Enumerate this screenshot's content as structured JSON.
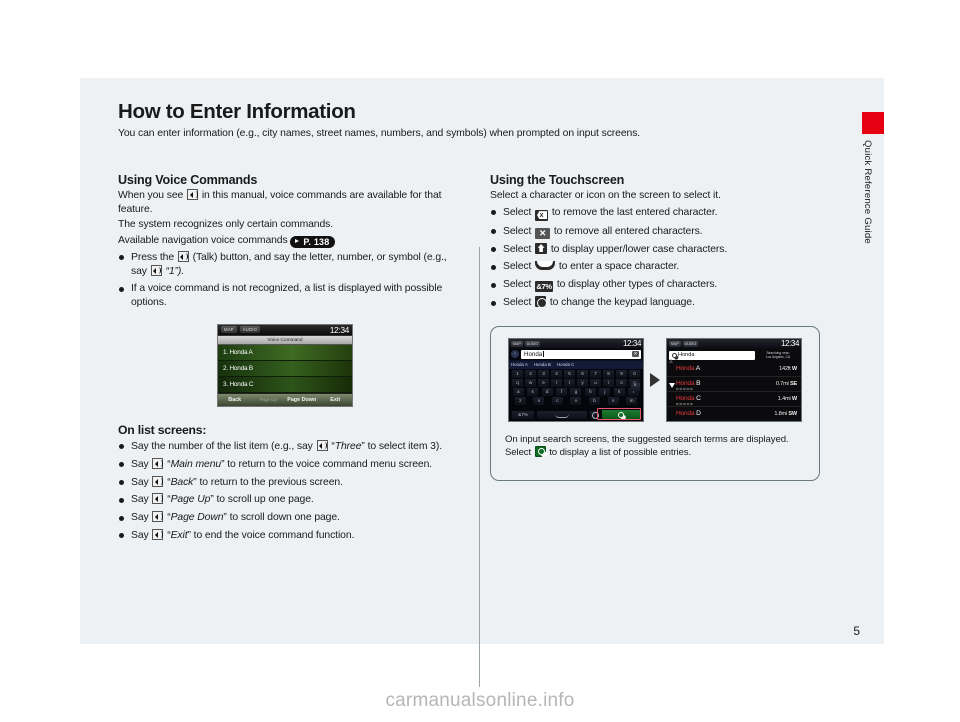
{
  "page": {
    "title": "How to Enter Information",
    "subtitle": "You can enter information (e.g., city names, street names, numbers, and symbols) when prompted on input screens.",
    "page_number": "5",
    "sidebar_label": "Quick Reference Guide",
    "sidebar_tab_color": "#e60012",
    "watermark": "carmanualsonline.info"
  },
  "left_column": {
    "heading": "Using Voice Commands",
    "para1_a": "When you see",
    "para1_b": "in this manual, voice commands are available for that feature.",
    "para2": "The system recognizes only certain commands.",
    "para3": "Available navigation voice commands",
    "page_ref": "P. 138",
    "bullets": [
      {
        "a": "Press the",
        "b": "(Talk) button, and say the letter, number, or symbol (e.g., say",
        "c": "“1”).",
        "has_second_icon": true
      },
      {
        "a": "If a voice command is not recognized, a list is displayed with possible options.",
        "b": "",
        "c": "",
        "has_second_icon": false
      }
    ],
    "nav_screen": {
      "chip_map": "MAP",
      "chip_audio": "AUDIO",
      "time": "12:34",
      "screen_title": "Voice Command",
      "list": [
        "1. Honda A",
        "2. Honda B",
        "3. Honda C"
      ],
      "buttons": [
        "Back",
        "Page Up",
        "Page Down",
        "Exit"
      ]
    },
    "subheading": "On list screens:",
    "list_bullets": [
      {
        "pre": "Say the number of the list item (e.g., say",
        "cmd": "Three",
        "post": "to select item 3)."
      },
      {
        "pre": "Say",
        "cmd": "Main menu",
        "post": "to return to the voice command menu screen."
      },
      {
        "pre": "Say",
        "cmd": "Back",
        "post": "to return to the previous screen."
      },
      {
        "pre": "Say",
        "cmd": "Page Up",
        "post": "to scroll up one page."
      },
      {
        "pre": "Say",
        "cmd": "Page Down",
        "post": "to scroll down one page."
      },
      {
        "pre": "Say",
        "cmd": "Exit",
        "post": "to end the voice command function."
      }
    ]
  },
  "right_column": {
    "heading": "Using the Touchscreen",
    "intro": "Select a character or icon on the screen to select it.",
    "bullets": [
      {
        "pre": "Select",
        "icon": "delete-character-key-icon",
        "post": "to remove the last entered character."
      },
      {
        "pre": "Select",
        "icon": "clear-all-key-icon",
        "post": "to remove all entered characters."
      },
      {
        "pre": "Select",
        "icon": "shift-key-icon",
        "post": "to display upper/lower case characters."
      },
      {
        "pre": "Select",
        "icon": "space-key-icon",
        "post": "to enter a space character."
      },
      {
        "pre": "Select",
        "icon": "symbols-key-icon",
        "label": "&7%",
        "post": "to display other types of characters."
      },
      {
        "pre": "Select",
        "icon": "keypad-language-key-icon",
        "post": "to change the keypad language."
      }
    ],
    "callout": {
      "caption_pre": "On input search screens, the suggested search terms are displayed. Select",
      "caption_icon": "search-key-icon",
      "caption_post": "to display a list of possible entries.",
      "keyboard_screen": {
        "chip_map": "MAP",
        "chip_audio": "AUDIO",
        "time": "12:34",
        "input_value": "Honda",
        "suggestions": [
          "Honda A",
          "Honda B",
          "Honda C"
        ],
        "row1": [
          "1",
          "2",
          "3",
          "4",
          "5",
          "6",
          "7",
          "8",
          "9",
          "0"
        ],
        "row2": [
          "q",
          "w",
          "e",
          "r",
          "t",
          "y",
          "u",
          "i",
          "o",
          "p"
        ],
        "row3": [
          "a",
          "s",
          "d",
          "f",
          "g",
          "h",
          "j",
          "k",
          "l"
        ],
        "row4": [
          "z",
          "x",
          "c",
          "v",
          "b",
          "n",
          "m"
        ],
        "symbols_key": "&7%"
      },
      "results_screen": {
        "chip_map": "MAP",
        "chip_audio": "AUDIO",
        "time": "12:34",
        "search_value": "Honda",
        "meta_line1": "Searching near:",
        "meta_line2": "Los Angeles, CA",
        "rows": [
          {
            "brand": "Honda",
            "suffix": "A",
            "distance": "142",
            "unit": "ft",
            "dir": "W"
          },
          {
            "brand": "Honda",
            "suffix": "B",
            "distance": "0.7",
            "unit": "mi",
            "dir": "SE"
          },
          {
            "brand": "Honda",
            "suffix": "C",
            "distance": "1.4",
            "unit": "mi",
            "dir": "W"
          },
          {
            "brand": "Honda",
            "suffix": "D",
            "distance": "1.8",
            "unit": "mi",
            "dir": "SW"
          }
        ]
      }
    }
  }
}
